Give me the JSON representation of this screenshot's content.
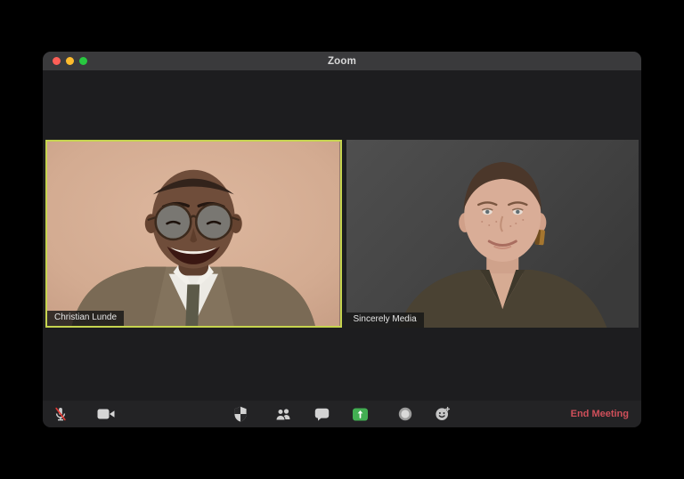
{
  "window": {
    "title": "Zoom"
  },
  "participants": [
    {
      "name": "Christian Lunde",
      "active_speaker": true
    },
    {
      "name": "Sincerely Media",
      "active_speaker": false
    }
  ],
  "toolbar": {
    "buttons": [
      {
        "id": "mute",
        "icon": "microphone-muted-icon",
        "state": "muted"
      },
      {
        "id": "video",
        "icon": "video-camera-icon",
        "state": "on"
      },
      {
        "id": "security",
        "icon": "shield-icon"
      },
      {
        "id": "participants",
        "icon": "participants-icon"
      },
      {
        "id": "chat",
        "icon": "chat-bubble-icon"
      },
      {
        "id": "share-screen",
        "icon": "share-screen-icon"
      },
      {
        "id": "record",
        "icon": "record-icon"
      },
      {
        "id": "reactions",
        "icon": "reactions-icon"
      }
    ],
    "end_meeting_label": "End Meeting"
  },
  "colors": {
    "active_speaker_border": "#c6d44f",
    "end_meeting": "#cf4f5a",
    "share_green": "#42ae52",
    "mic_slash": "#e03a34",
    "traffic_red": "#ff5f57",
    "traffic_yellow": "#febc2e",
    "traffic_green": "#28c840"
  }
}
